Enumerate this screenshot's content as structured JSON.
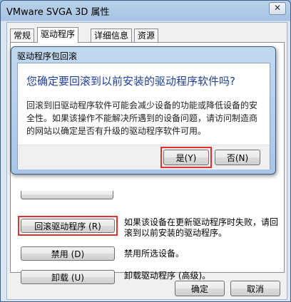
{
  "window": {
    "title": "VMware SVGA 3D 属性",
    "close_icon": "close-icon"
  },
  "tabs": [
    {
      "label": "常规"
    },
    {
      "label": "驱动程序"
    },
    {
      "label": "详细信息"
    },
    {
      "label": "资源"
    }
  ],
  "driver_panel": {
    "rollback_label": "回滚驱动程序 (R)",
    "rollback_desc": "如果该设备在更新驱动程序时失败，请回滚到以前安装的驱动程序。",
    "disable_label": "禁用 (D)",
    "disable_desc": "禁用所选设备。",
    "uninstall_label": "卸载 (U)",
    "uninstall_desc": "卸载驱动程序 (高级)。"
  },
  "footer": {
    "ok_label": "确定",
    "cancel_label": "取消"
  },
  "dialog": {
    "title": "驱动程序包回滚",
    "heading": "您确定要回滚到以前安装的驱动程序软件吗?",
    "body": "回滚到旧驱动程序软件可能会减少设备的功能或降低设备的安全性。如果该操作不能解决所遇到的设备问题，请访问制造商的网站以确定是否有升级的驱动程序软件可用。",
    "yes_label": "是(Y)",
    "no_label": "否(N)"
  },
  "colors": {
    "highlight": "#e03030",
    "heading": "#1e3f9a"
  }
}
